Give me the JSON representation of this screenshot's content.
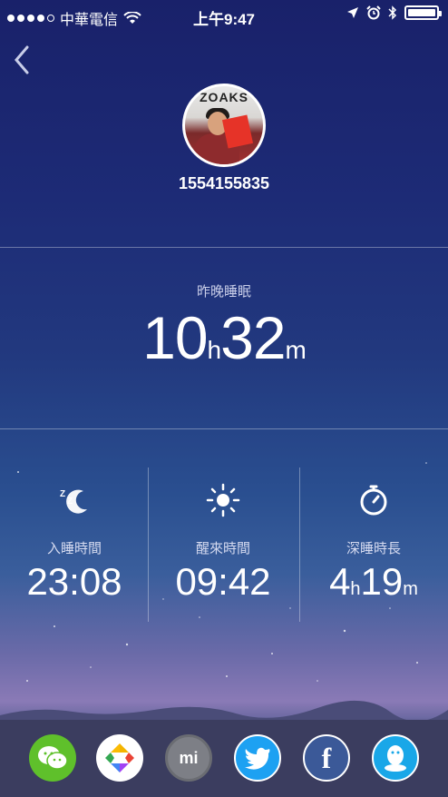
{
  "status_bar": {
    "carrier": "中華電信",
    "time": "上午9:47"
  },
  "profile": {
    "avatar_text": "ZOAKS",
    "user_id": "1554155835"
  },
  "last_night": {
    "label": "昨晚睡眠",
    "hours": "10",
    "hours_unit": "h",
    "minutes": "32",
    "minutes_unit": "m"
  },
  "stats": [
    {
      "label": "入睡時間",
      "value": "23:08",
      "icon": "sleep-moon-icon"
    },
    {
      "label": "醒來時間",
      "value": "09:42",
      "icon": "sun-icon"
    },
    {
      "label": "深睡時長",
      "hours": "4",
      "hours_unit": "h",
      "minutes": "19",
      "minutes_unit": "m",
      "icon": "stopwatch-icon"
    }
  ],
  "share": [
    {
      "name": "wechat",
      "color": "#5fc02b"
    },
    {
      "name": "moments",
      "color": "#ffffff"
    },
    {
      "name": "mi",
      "color": "#7d7f86",
      "label": "mi"
    },
    {
      "name": "twitter",
      "color": "#1da1f2"
    },
    {
      "name": "facebook",
      "color": "#3b5998",
      "label": "f"
    },
    {
      "name": "qq",
      "color": "#19a7e8"
    }
  ]
}
